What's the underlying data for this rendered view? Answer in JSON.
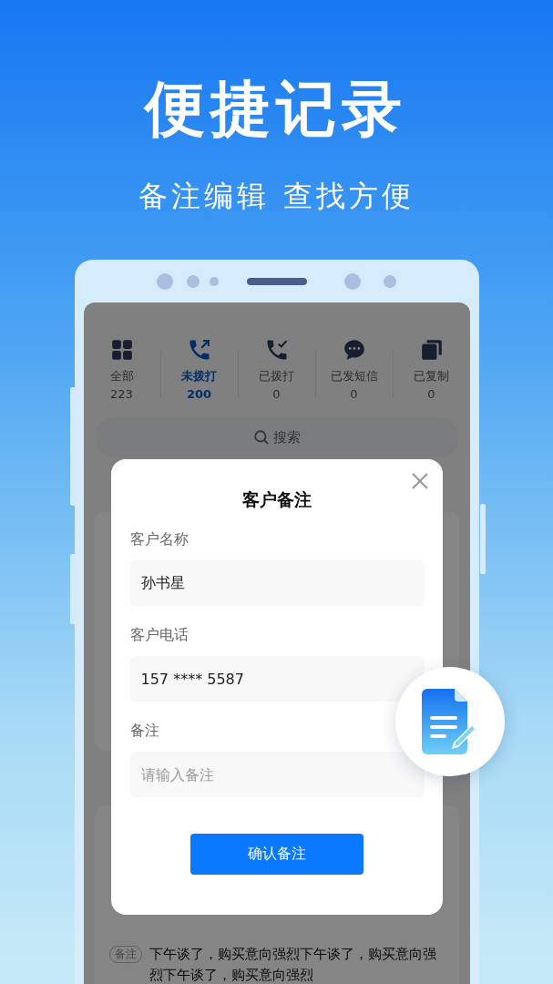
{
  "header": {
    "title": "便捷记录",
    "subtitle": "备注编辑 查找方便"
  },
  "tabs": [
    {
      "kind": "grid",
      "label": "全部",
      "count": "223",
      "selected": false
    },
    {
      "kind": "outgoing",
      "label": "未拨打",
      "count": "200",
      "selected": true
    },
    {
      "kind": "dialed",
      "label": "已拨打",
      "count": "0",
      "selected": false
    },
    {
      "kind": "message",
      "label": "已发短信",
      "count": "0",
      "selected": false
    },
    {
      "kind": "copy",
      "label": "已复制",
      "count": "0",
      "selected": false
    }
  ],
  "search": {
    "placeholder": "搜索"
  },
  "list": {
    "note": {
      "tag": "备注",
      "text": "下午谈了，购买意向强烈下午谈了，购买意向强烈下午谈了，购买意向强烈"
    }
  },
  "dialog": {
    "title": "客户备注",
    "fields": [
      {
        "label": "客户名称",
        "value": "孙书星"
      },
      {
        "label": "客户电话",
        "value": "157 **** 5587"
      },
      {
        "label": "备注",
        "placeholder": "请输入备注"
      }
    ],
    "confirm": "确认备注"
  }
}
